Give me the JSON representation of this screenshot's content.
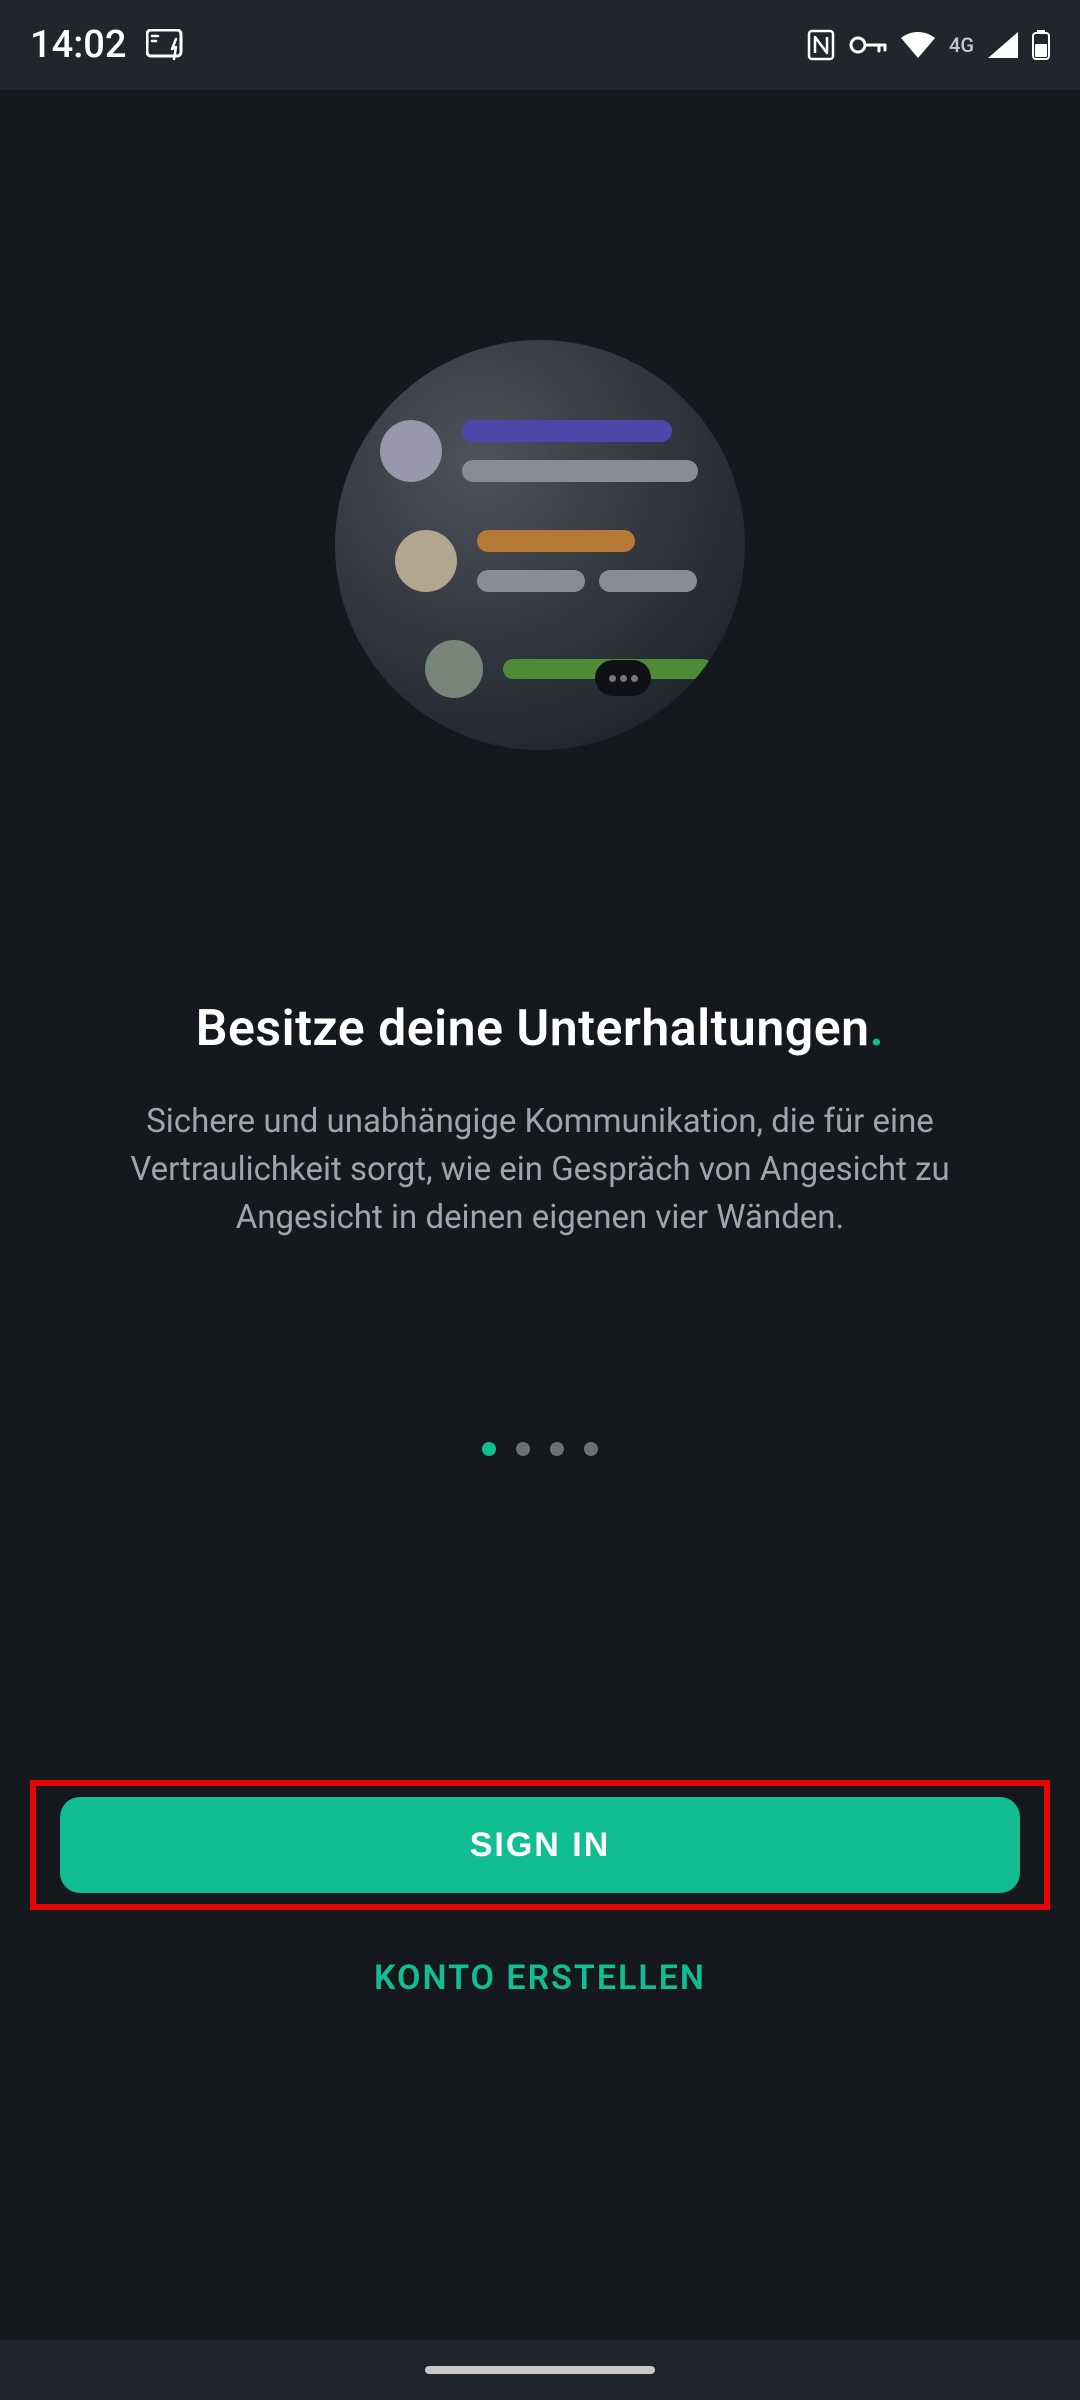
{
  "status": {
    "time": "14:02",
    "network_label": "4G"
  },
  "onboarding": {
    "headline": "Besitze deine Unterhaltungen",
    "headline_dot": ".",
    "subtitle": "Sichere und unabhängige Kommunikation, die für eine Vertraulichkeit sorgt, wie ein Gespräch von Angesicht zu Angesicht in deinen eigenen vier Wänden.",
    "page_count": 4,
    "active_page": 1
  },
  "buttons": {
    "sign_in": "SIGN IN",
    "create_account": "KONTO ERSTELLEN"
  },
  "colors": {
    "accent": "#11bd93",
    "highlight_border": "#e40606"
  }
}
